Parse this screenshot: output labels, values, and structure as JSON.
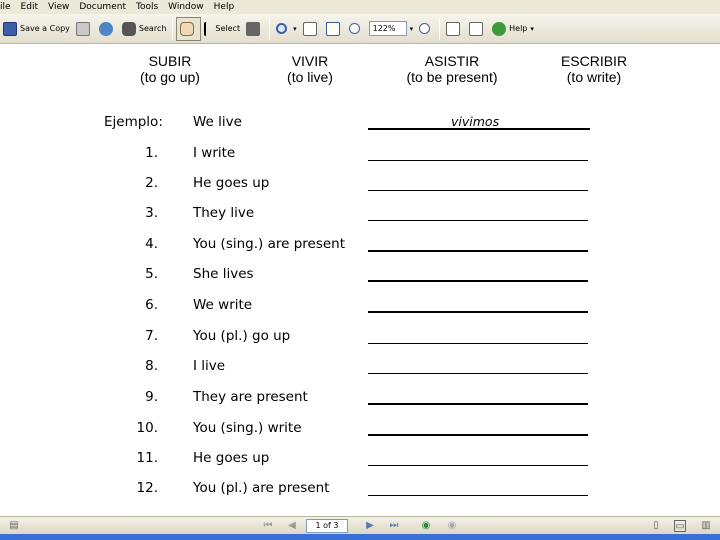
{
  "menu": [
    "ile",
    "Edit",
    "View",
    "Document",
    "Tools",
    "Window",
    "Help"
  ],
  "toolbar": {
    "save_copy": "Save a Copy",
    "search": "Search",
    "select": "Select",
    "zoom": "122%",
    "help": "Help"
  },
  "worksheet": {
    "headers": [
      {
        "verb": "SUBIR",
        "meaning": "(to go up)"
      },
      {
        "verb": "VIVIR",
        "meaning": "(to live)"
      },
      {
        "verb": "ASISTIR",
        "meaning": "(to be present)"
      },
      {
        "verb": "ESCRIBIR",
        "meaning": "(to write)"
      }
    ],
    "example": {
      "label": "Ejemplo:",
      "prompt": "We live",
      "answer": "vivimos"
    },
    "items": [
      {
        "num": "1.",
        "prompt": "I write"
      },
      {
        "num": "2.",
        "prompt": "He goes up"
      },
      {
        "num": "3.",
        "prompt": "They live"
      },
      {
        "num": "4.",
        "prompt": "You (sing.) are present"
      },
      {
        "num": "5.",
        "prompt": "She lives"
      },
      {
        "num": "6.",
        "prompt": "We write"
      },
      {
        "num": "7.",
        "prompt": "You (pl.) go up"
      },
      {
        "num": "8.",
        "prompt": "I live"
      },
      {
        "num": "9.",
        "prompt": "They are present"
      },
      {
        "num": "10.",
        "prompt": "You (sing.) write"
      },
      {
        "num": "11.",
        "prompt": "He goes up"
      },
      {
        "num": "12.",
        "prompt": "You (pl.) are present"
      }
    ]
  },
  "nav": {
    "page_indicator": "1 of 3"
  }
}
